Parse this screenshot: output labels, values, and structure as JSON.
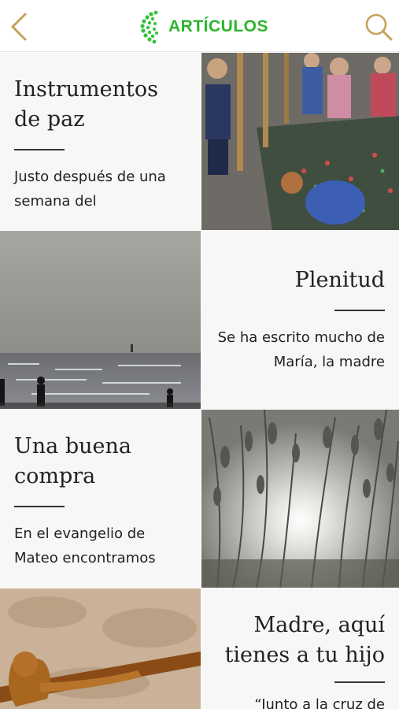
{
  "header": {
    "title": "ARTÍCULOS",
    "back_icon": "chevron-left-icon",
    "search_icon": "search-icon",
    "accent": "#c6a15b",
    "brand_color": "#2db52d"
  },
  "articles": [
    {
      "title": "Instrumentos de paz",
      "excerpt": "Justo después de una semana del",
      "image": "street-memorial-photo"
    },
    {
      "title": "Plenitud",
      "excerpt": "Se ha escrito mucho de María, la madre",
      "image": "seaside-figures-photo"
    },
    {
      "title": "Una buena compra",
      "excerpt": "En el evangelio de Mateo encontramos",
      "image": "grass-sunlight-photo"
    },
    {
      "title": "Madre, aquí tienes a tu hijo",
      "excerpt": "“Junto a la cruz de",
      "image": "crucifix-sculpture-photo"
    }
  ]
}
